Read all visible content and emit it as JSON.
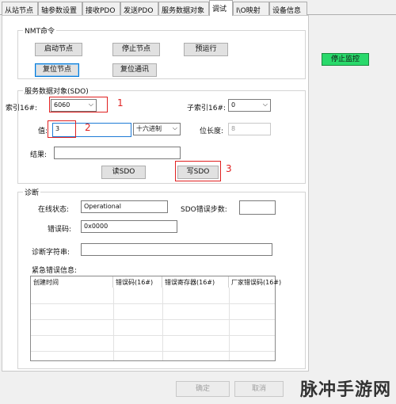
{
  "tabs": [
    {
      "label": "从站节点"
    },
    {
      "label": "轴参数设置"
    },
    {
      "label": "接收PDO"
    },
    {
      "label": "发送PDO"
    },
    {
      "label": "服务数据对象"
    },
    {
      "label": "调试"
    },
    {
      "label": "I\\O映射"
    },
    {
      "label": "设备信息"
    }
  ],
  "nmt": {
    "title": "NMT命令",
    "buttons": [
      "启动节点",
      "停止节点",
      "预运行",
      "复位节点",
      "复位通讯"
    ]
  },
  "stop_monitor_label": "停止监控",
  "sdo": {
    "title": "服务数据对象(SDO)",
    "index_label": "索引16#:",
    "index_value": "6060",
    "subindex_label": "子索引16#:",
    "subindex_value": "0",
    "value_label": "值:",
    "value_value": "3",
    "format_value": "十六进制",
    "length_label": "位长度:",
    "length_value": "8",
    "result_label": "结果:",
    "result_value": "",
    "read_label": "读SDO",
    "write_label": "写SDO"
  },
  "annotations": [
    "1",
    "2",
    "3"
  ],
  "diag": {
    "title": "诊断",
    "online_label": "在线状态:",
    "online_value": "Operational",
    "sdo_err_label": "SDO错误步数:",
    "sdo_err_value": "",
    "err_code_label": "错误码:",
    "err_code_value": "0x0000",
    "diag_str_label": "诊断字符串:",
    "diag_str_value": "",
    "emergency_label": "紧急错误信息:",
    "columns": [
      "创建时间",
      "错误码(16#)",
      "错误寄存器(16#)",
      "厂家错误码(16#)"
    ]
  },
  "footer": {
    "ok_label": "确定",
    "cancel_label": "取消"
  },
  "watermark": "脉冲手游网",
  "colors": {
    "accent_red": "#e02020",
    "stop_green": "#29d96b",
    "focus_blue": "#0078d7"
  }
}
